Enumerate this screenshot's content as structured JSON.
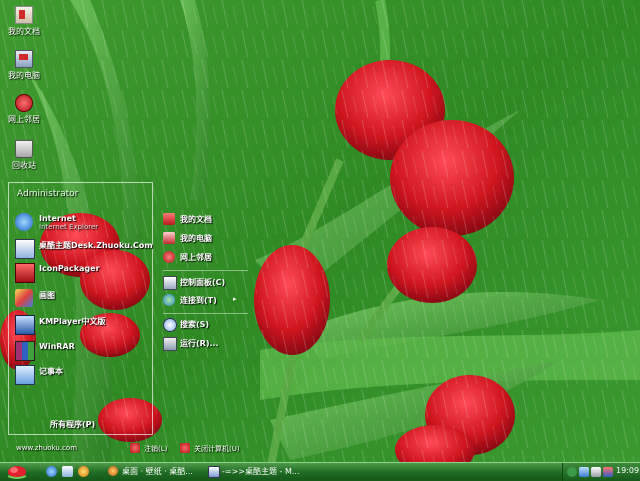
{
  "desktop_icons": [
    {
      "label": "我的文档",
      "icon": "my-documents-icon"
    },
    {
      "label": "我的电脑",
      "icon": "my-computer-icon"
    },
    {
      "label": "网上邻居",
      "icon": "network-places-icon"
    },
    {
      "label": "回收站",
      "icon": "recycle-bin-icon"
    }
  ],
  "start_menu": {
    "user": "Administrator",
    "programs": [
      {
        "title": "Internet",
        "subtitle": "Internet Explorer",
        "icon": "internet-explorer-icon"
      },
      {
        "title": "桌酷主题Desk.Zhuoku.Com",
        "subtitle": "",
        "icon": "zhuoku-theme-icon"
      },
      {
        "title": "IconPackager",
        "subtitle": "",
        "icon": "iconpackager-icon"
      },
      {
        "title": "画图",
        "subtitle": "",
        "icon": "paint-icon"
      },
      {
        "title": "KMPlayer中文版",
        "subtitle": "",
        "icon": "kmplayer-icon"
      },
      {
        "title": "WinRAR",
        "subtitle": "",
        "icon": "winrar-icon"
      },
      {
        "title": "记事本",
        "subtitle": "",
        "icon": "notepad-icon"
      }
    ],
    "all_programs": "所有程序(P)",
    "right_items": [
      {
        "label": "我的文档",
        "icon": "my-documents-icon"
      },
      {
        "label": "我的电脑",
        "icon": "my-computer-icon"
      },
      {
        "label": "网上邻居",
        "icon": "network-places-icon"
      },
      {
        "label": "控制面板(C)",
        "icon": "control-panel-icon"
      },
      {
        "label": "连接到(T)",
        "icon": "connect-to-icon"
      },
      {
        "label": "搜索(S)",
        "icon": "search-icon"
      },
      {
        "label": "运行(R)...",
        "icon": "run-icon"
      }
    ],
    "submenu_arrow": "▸",
    "site_text": "www.zhuoku.com",
    "logoff": "注销(L)",
    "shutdown": "关闭计算机(U)"
  },
  "taskbar": {
    "tasks": [
      {
        "label": "桌面 · 壁纸 · 桌酷..."
      },
      {
        "label": "-=>>桌酷主题 - M..."
      }
    ],
    "clock": "19:09"
  },
  "colors": {
    "taskbar": "#1f6a22",
    "accent_red": "#d4202e"
  }
}
